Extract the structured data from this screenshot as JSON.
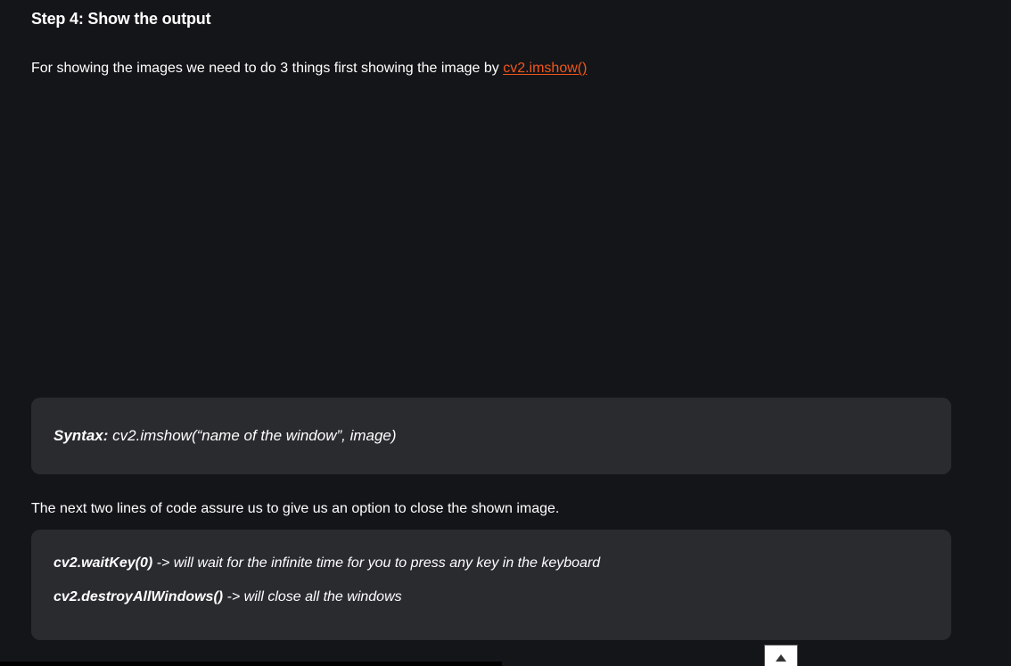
{
  "heading": "Step 4: Show the output",
  "intro": {
    "text": "For showing the images we need to do 3 things first showing the image by ",
    "link": "cv2.imshow()"
  },
  "syntax": {
    "label": "Syntax:",
    "code": " cv2.imshow(“name of the window”, image)"
  },
  "next_paragraph": "The next two lines of code assure us to give us an option to close the shown image.",
  "code_lines": [
    {
      "code": "cv2.waitKey(0)",
      "desc": " -> will wait for the infinite time for you to press any key in the keyboard"
    },
    {
      "code": "cv2.destroyAllWindows()",
      "desc": " -> will close all the windows"
    }
  ],
  "colors": {
    "background": "#141518",
    "box": "#2a2b2f",
    "link": "#f0561d"
  },
  "icons": {
    "scroll_top": "arrow-up-icon"
  }
}
